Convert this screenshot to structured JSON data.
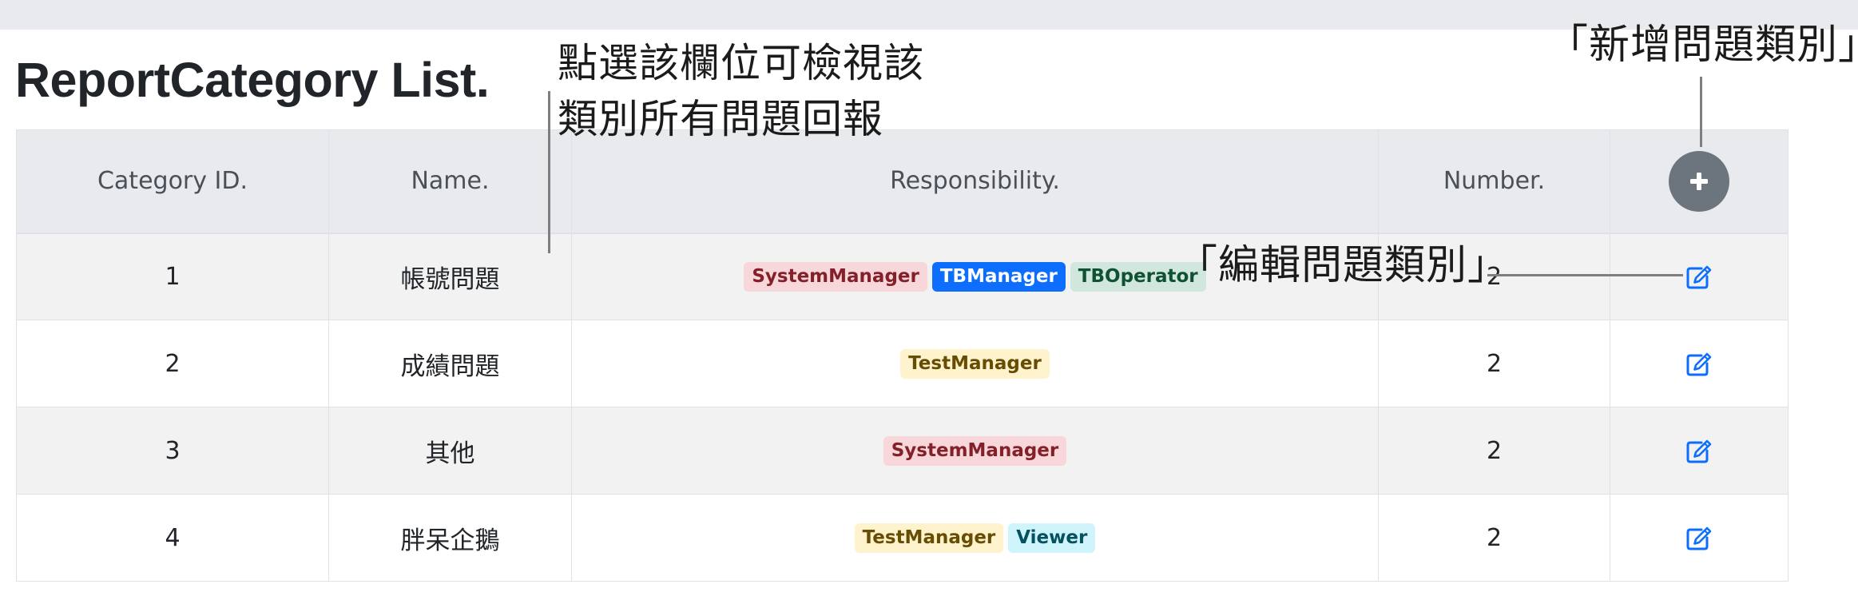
{
  "page": {
    "title": "ReportCategory List."
  },
  "table": {
    "headers": {
      "id": "Category ID.",
      "name": "Name.",
      "responsibility": "Responsibility.",
      "number": "Number."
    },
    "add_button_icon": "plus-icon",
    "edit_button_icon": "edit-icon",
    "rows": [
      {
        "id": "1",
        "name": "帳號問題",
        "number": "2",
        "badges": [
          {
            "label": "SystemManager",
            "bg": "#f8d7da",
            "fg": "#842029"
          },
          {
            "label": "TBManager",
            "bg": "#0d6efd",
            "fg": "#ffffff"
          },
          {
            "label": "TBOperator",
            "bg": "#d1e7dd",
            "fg": "#0f5132"
          }
        ]
      },
      {
        "id": "2",
        "name": "成績問題",
        "number": "2",
        "badges": [
          {
            "label": "TestManager",
            "bg": "#fff3cd",
            "fg": "#664d03"
          }
        ]
      },
      {
        "id": "3",
        "name": "其他",
        "number": "2",
        "badges": [
          {
            "label": "SystemManager",
            "bg": "#f8d7da",
            "fg": "#842029"
          }
        ]
      },
      {
        "id": "4",
        "name": "胖呆企鵝",
        "number": "2",
        "badges": [
          {
            "label": "TestManager",
            "bg": "#fff3cd",
            "fg": "#664d03"
          },
          {
            "label": "Viewer",
            "bg": "#cff4fc",
            "fg": "#055160"
          }
        ]
      }
    ]
  },
  "annotations": {
    "view_line1": "點選該欄位可檢視該",
    "view_line2": "類別所有問題回報",
    "add": "「新增問題類別」",
    "edit": "「編輯問題類別」"
  },
  "colors": {
    "header_bg": "#e9eaee",
    "add_button": "#6c757d",
    "edit_icon": "#0d6efd",
    "leader_line": "#7f7f7f"
  }
}
